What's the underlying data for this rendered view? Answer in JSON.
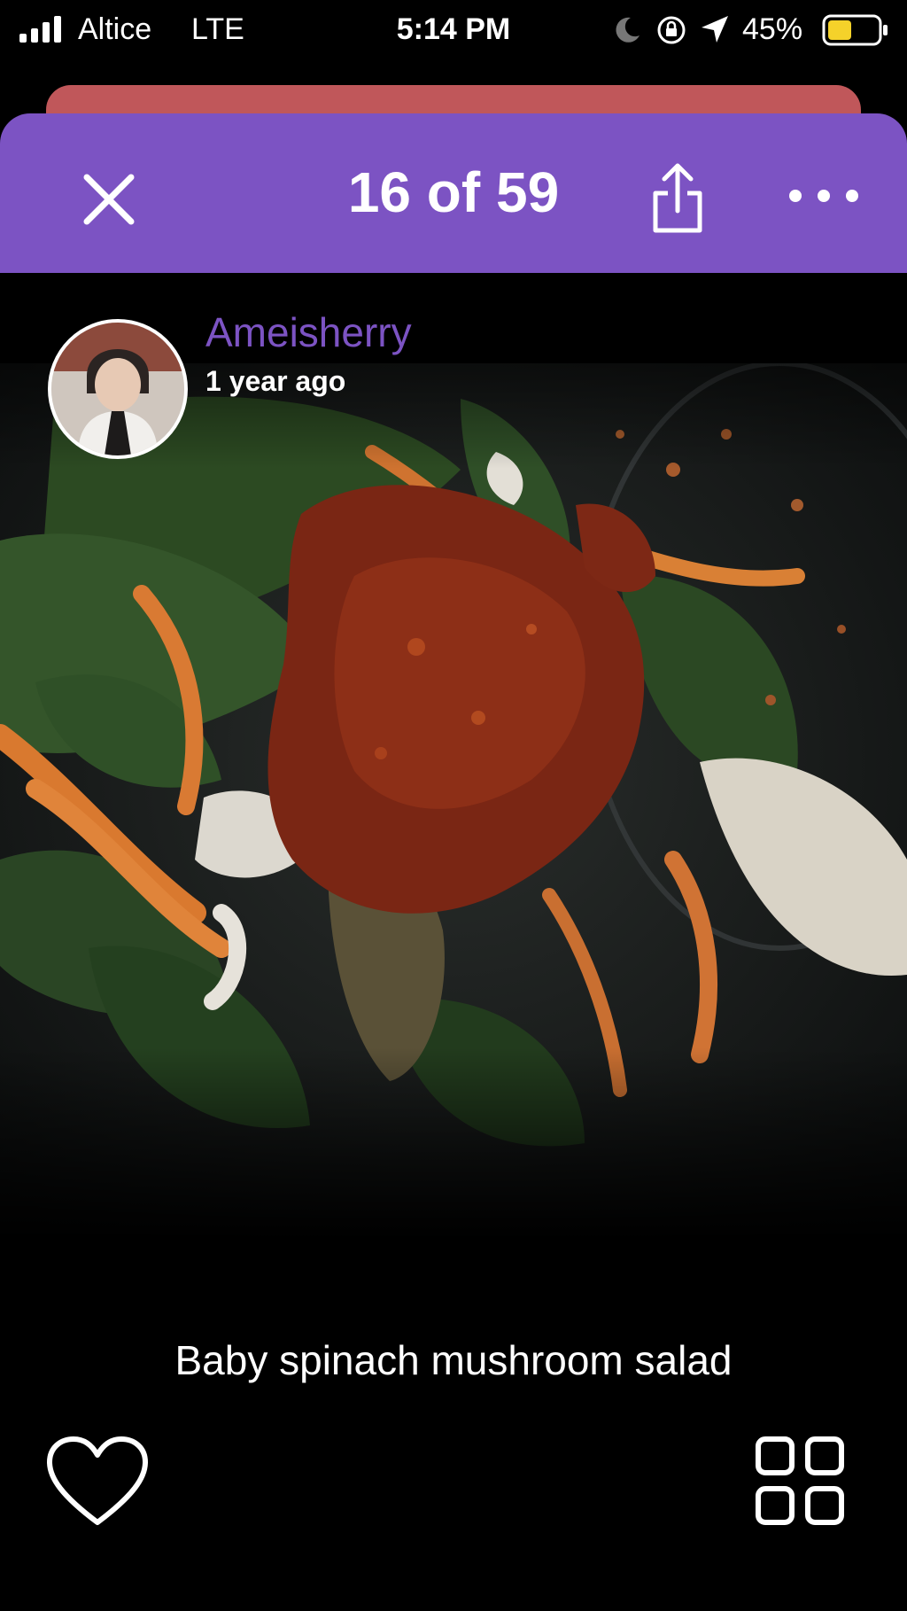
{
  "status_bar": {
    "carrier": "Altice",
    "network": "LTE",
    "time": "5:14 PM",
    "battery_percent": "45%",
    "icons": [
      "signal-icon",
      "moon-icon",
      "orientation-lock-icon",
      "location-arrow-icon",
      "battery-icon"
    ]
  },
  "header": {
    "counter": "16 of 59",
    "icons": [
      "close-icon",
      "share-icon",
      "more-icon"
    ]
  },
  "post": {
    "username": "Ameisherry",
    "timestamp": "1 year ago",
    "caption": "Baby spinach mushroom salad"
  },
  "footer": {
    "icons": [
      "heart-icon",
      "grid-icon"
    ]
  },
  "colors": {
    "accent": "#7c53c3",
    "sheet_back": "#c0575a",
    "background": "#000000"
  }
}
